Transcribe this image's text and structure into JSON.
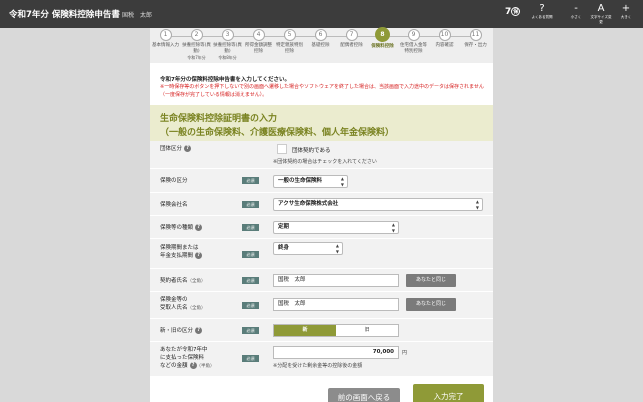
{
  "header": {
    "title": "令和7年分 保険料控除申告書",
    "user": "国税　太郎",
    "year_badge_num": "7",
    "year_badge_mark": "保",
    "buttons": [
      {
        "glyph": "?",
        "caption": "よくある質問"
      },
      {
        "glyph": "-",
        "caption": "小さく"
      },
      {
        "glyph": "A",
        "caption": "文字サイズ変更"
      },
      {
        "glyph": "+",
        "caption": "大きく"
      }
    ]
  },
  "steps": [
    {
      "num": "1",
      "label": "基本情報入力",
      "sub": ""
    },
    {
      "num": "2",
      "label": "扶養控除等(異動)",
      "sub": "令和7年分"
    },
    {
      "num": "3",
      "label": "扶養控除等(異動)",
      "sub": "令和8年分"
    },
    {
      "num": "4",
      "label": "所得金額調整控除",
      "sub": ""
    },
    {
      "num": "5",
      "label": "特定親族特別控除",
      "sub": ""
    },
    {
      "num": "6",
      "label": "基礎控除",
      "sub": ""
    },
    {
      "num": "7",
      "label": "配偶者控除",
      "sub": ""
    },
    {
      "num": "8",
      "label": "保険料控除",
      "sub": ""
    },
    {
      "num": "9",
      "label": "住宅借入金等特別控除",
      "sub": ""
    },
    {
      "num": "10",
      "label": "内容確認",
      "sub": ""
    },
    {
      "num": "11",
      "label": "保存・出力",
      "sub": ""
    }
  ],
  "intro": {
    "line1": "令和7年分の保険料控除申告書を入力してください。",
    "line2": "※一時保存等のボタンを押下しないで別の画面へ遷移した場合やソフトウェアを終了した場合は、当該画面で入力途中のデータは保存されません（一度保存が完了している情報は消えません）。"
  },
  "section": {
    "title1": "生命保険料控除証明書の入力",
    "title2": "（一般の生命保険料、介護医療保険料、個人年金保険料）"
  },
  "required_label": "必須",
  "help_mark": "?",
  "form": {
    "group_label": "団体区分",
    "group_checkbox_label": "団体契約である",
    "group_note": "※団体契約の場合はチェックを入れてください",
    "insurance_type_label": "保険の区分",
    "insurance_type_value": "一般の生命保険料",
    "company_label": "保険会社名",
    "company_value": "アクサ生命保険株式会社",
    "kind_label": "保険等の種類",
    "kind_value": "定期",
    "period_label_1": "保険期間または",
    "period_label_2": "年金支払期間",
    "period_value": "終身",
    "contractor_label": "契約者氏名",
    "contractor_suffix": "（全角）",
    "contractor_value": "国税　太郎",
    "same_button": "あなたと同じ",
    "beneficiary_label_1": "保険金等の",
    "beneficiary_label_2": "受取人氏名",
    "beneficiary_suffix": "（全角）",
    "beneficiary_value": "国税　太郎",
    "newold_label": "新・旧の区分",
    "newold_options": [
      "新",
      "旧"
    ],
    "amount_label_1": "あなたが令和7年中",
    "amount_label_2": "に支払った保険料",
    "amount_label_3": "などの金額",
    "amount_suffix": "（半角）",
    "amount_value": "70,000",
    "amount_unit": "円",
    "amount_note": "※分配を受けた剰余金等の控除後の金額"
  },
  "footer": {
    "back": "前の画面へ戻る",
    "done": "入力完了"
  }
}
